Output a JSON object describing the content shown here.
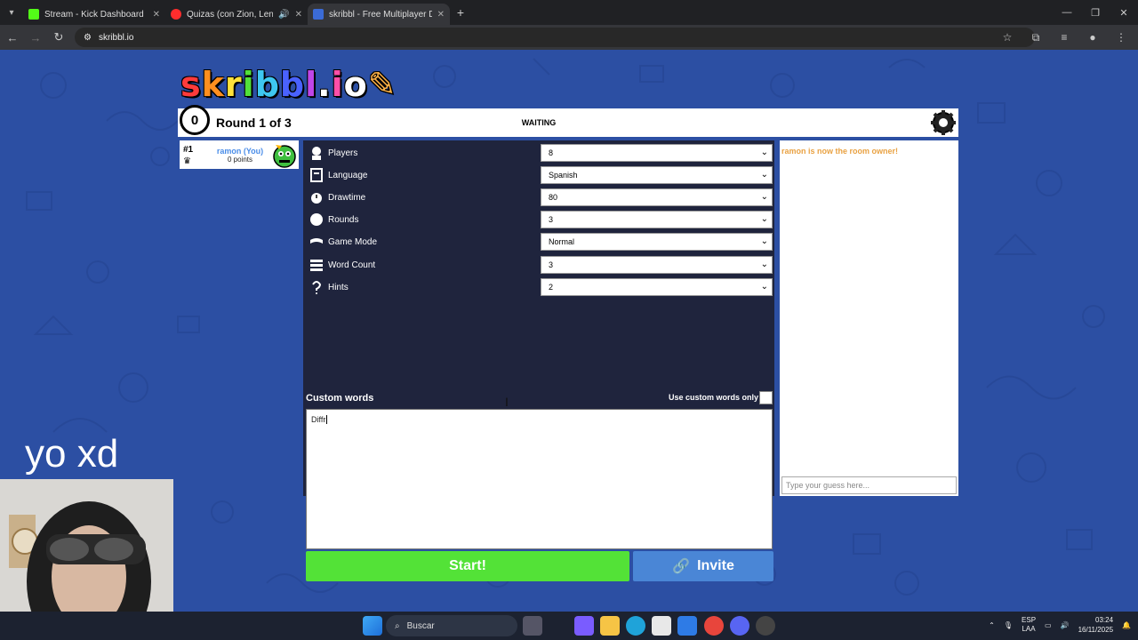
{
  "browser": {
    "tabs": [
      {
        "title": "Stream - Kick Dashboard",
        "fav_color": "#53fc18"
      },
      {
        "title": "Quizas (con Zion, Lenny Tav",
        "fav_color": "#ff2d2d"
      },
      {
        "title": "skribbl - Free Multiplayer Draw",
        "fav_color": "#3b6bd6"
      }
    ],
    "new_tab": "+",
    "url": "skribbl.io"
  },
  "game": {
    "logo": {
      "letters": [
        "s",
        "k",
        "r",
        "i",
        "b",
        "b",
        "l",
        ".",
        "i",
        "o"
      ],
      "colors": [
        "#ff3b3b",
        "#ff8f1f",
        "#ffe23a",
        "#52e03a",
        "#3ec7f0",
        "#4a62ff",
        "#c046e8",
        "#ffffff",
        "#ff4fa8",
        "#ffffff"
      ]
    },
    "timer": "0",
    "round": "Round 1 of 3",
    "status": "WAITING",
    "player": {
      "rank": "#1",
      "name": "ramon (You)",
      "points": "0 points"
    },
    "settings": [
      {
        "label": "Players",
        "value": "8",
        "icon": "player-icon"
      },
      {
        "label": "Language",
        "value": "Spanish",
        "icon": "language-icon"
      },
      {
        "label": "Drawtime",
        "value": "80",
        "icon": "clock-icon"
      },
      {
        "label": "Rounds",
        "value": "3",
        "icon": "rounds-icon"
      },
      {
        "label": "Game Mode",
        "value": "Normal",
        "icon": "gamemode-icon"
      },
      {
        "label": "Word Count",
        "value": "3",
        "icon": "wordcount-icon"
      },
      {
        "label": "Hints",
        "value": "2",
        "icon": "hint-icon"
      }
    ],
    "custom_words_label": "Custom words",
    "custom_words_only_label": "Use custom words only",
    "custom_words_value": "Diffr",
    "start_label": "Start!",
    "invite_label": "Invite",
    "chat": {
      "message": "ramon is now the room owner!",
      "placeholder": "Type your guess here..."
    }
  },
  "overlay_text": "yo xd",
  "taskbar": {
    "search_label": "Buscar",
    "lang_top": "ESP",
    "lang_bottom": "LAA",
    "time": "03:24",
    "date": "16/11/2025"
  }
}
